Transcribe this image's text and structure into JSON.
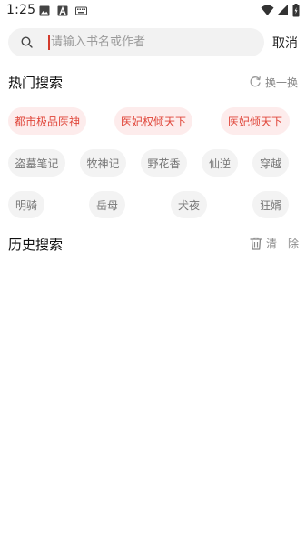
{
  "status_bar": {
    "time": "1:25"
  },
  "search": {
    "placeholder": "请输入书名或作者",
    "value": "",
    "cancel_label": "取消"
  },
  "hot_search": {
    "title": "热门搜索",
    "refresh_label": "换一换",
    "tags": [
      {
        "label": "都市极品医神",
        "highlighted": true
      },
      {
        "label": "医妃权倾天下",
        "highlighted": true
      },
      {
        "label": "医妃倾天下",
        "highlighted": true
      },
      {
        "label": "盗墓笔记",
        "highlighted": false
      },
      {
        "label": "牧神记",
        "highlighted": false
      },
      {
        "label": "野花香",
        "highlighted": false
      },
      {
        "label": "仙逆",
        "highlighted": false
      },
      {
        "label": "穿越",
        "highlighted": false
      },
      {
        "label": "明骑",
        "highlighted": false
      },
      {
        "label": "岳母",
        "highlighted": false
      },
      {
        "label": "犬夜",
        "highlighted": false
      },
      {
        "label": "狂婿",
        "highlighted": false
      }
    ]
  },
  "history": {
    "title": "历史搜索",
    "clear_char_1": "清",
    "clear_char_2": "除",
    "items": []
  },
  "colors": {
    "accent": "#e0463a",
    "hot_tag_bg": "#fdecec",
    "tag_bg": "#f3f3f3",
    "search_bg": "#f2f2f2",
    "muted_text": "#888888"
  },
  "icons": {
    "status_left": [
      "image-icon",
      "a-icon",
      "keyboard-icon"
    ],
    "status_right": [
      "wifi-icon",
      "signal-icon",
      "battery-icon"
    ],
    "search": "search-icon",
    "refresh": "refresh-icon",
    "clear": "trash-icon"
  }
}
